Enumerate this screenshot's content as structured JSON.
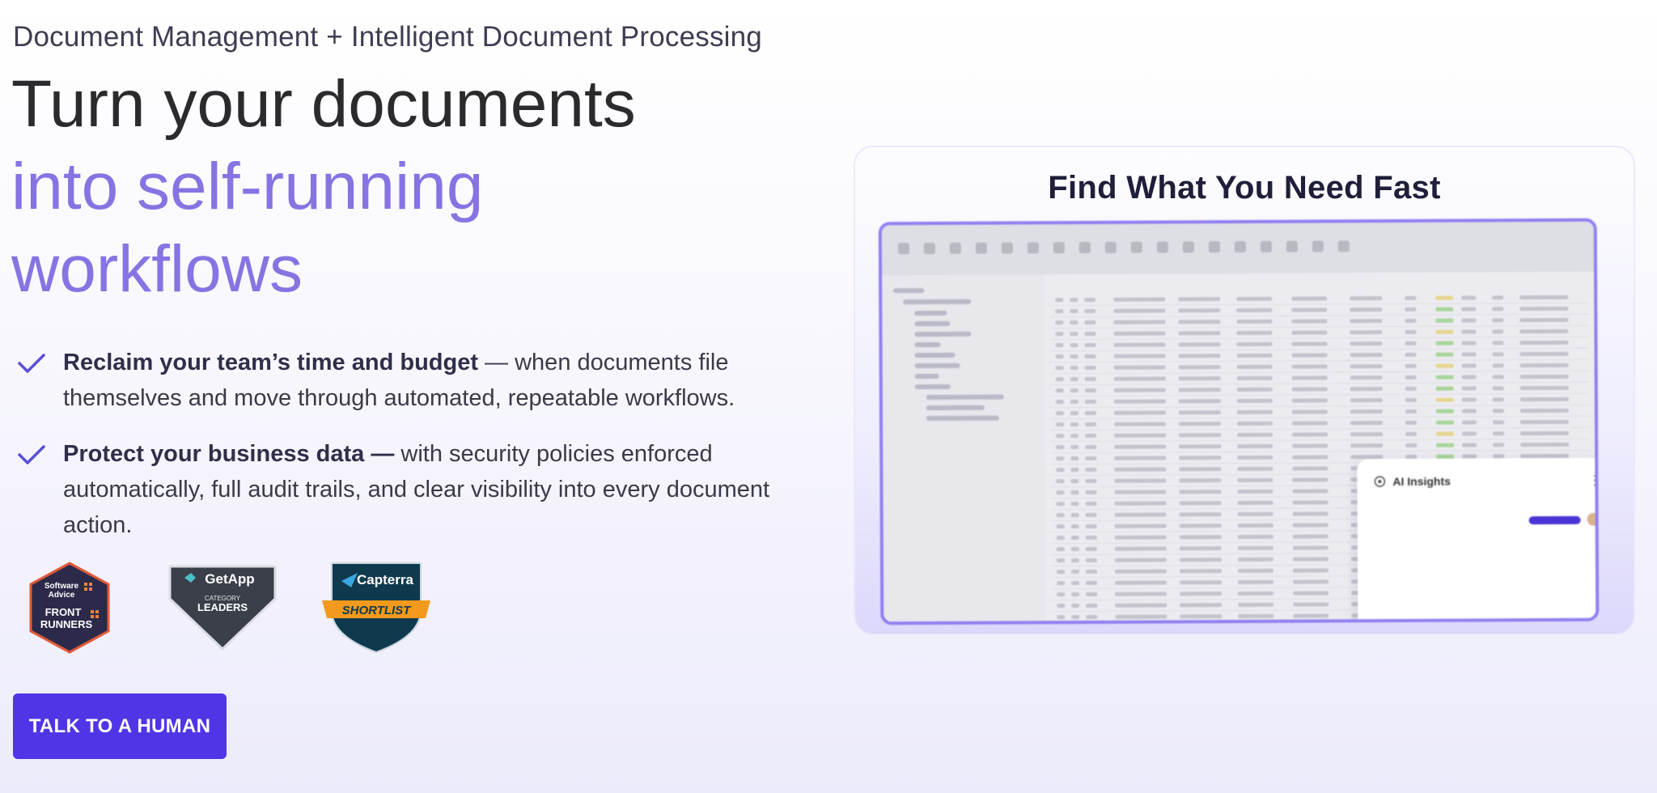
{
  "hero": {
    "eyebrow": "Document Management + Intelligent Document Processing",
    "headline_line1": "Turn your documents",
    "headline_line2": "into self-running",
    "headline_line3": "workflows"
  },
  "benefits": [
    {
      "bold": "Reclaim your team’s time and budget",
      "text": " — when documents file themselves and move through automated, repeatable workflows."
    },
    {
      "bold": "Protect your business data —",
      "text": " with security policies enforced automatically, full audit trails, and clear visibility into every document action."
    }
  ],
  "badges": {
    "software_advice": {
      "line1": "Software",
      "line2": "Advice",
      "line3": "FRONT",
      "line4": "RUNNERS"
    },
    "getapp": {
      "brand": "GetApp",
      "line1": "CATEGORY",
      "line2": "LEADERS"
    },
    "capterra": {
      "brand": "Capterra",
      "ribbon": "SHORTLIST"
    }
  },
  "cta": {
    "label": "TALK TO A HUMAN"
  },
  "showcase": {
    "title": "Find What You Need Fast",
    "ai_panel_title": "AI Insights"
  },
  "colors": {
    "accent_text": "#8773e2",
    "cta_bg": "#5035e6",
    "check": "#5b4fd6"
  }
}
